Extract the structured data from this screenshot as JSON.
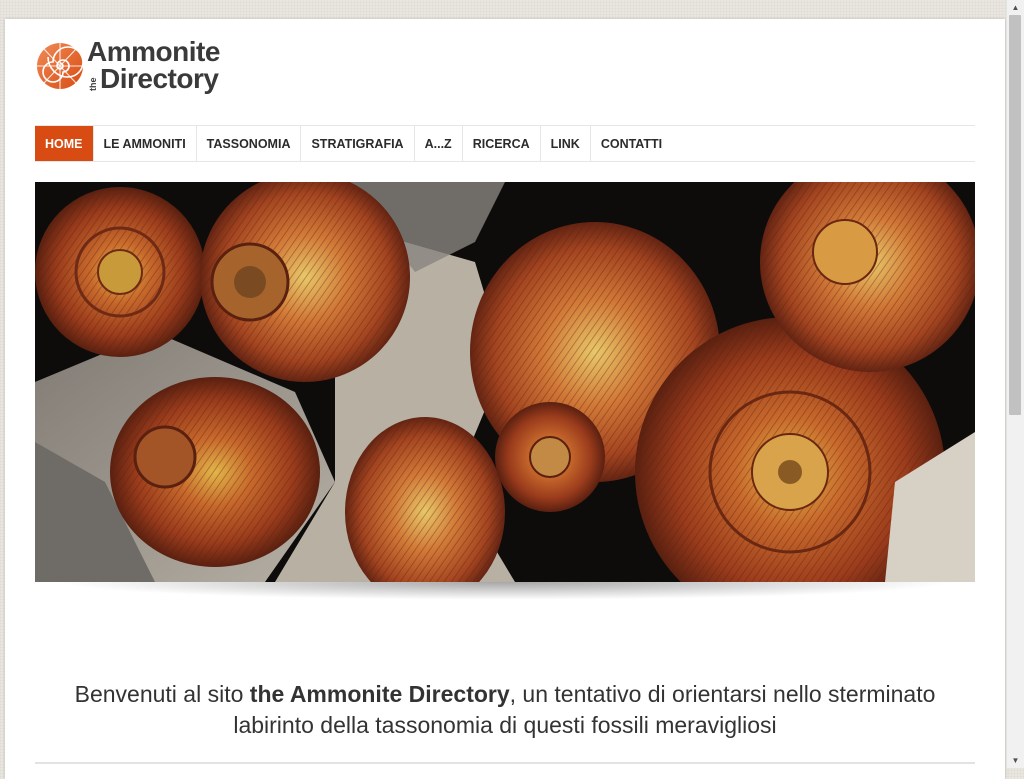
{
  "site": {
    "logo": {
      "line1": "Ammonite",
      "article": "the",
      "line2": "Directory",
      "icon": "ammonite-shell-icon"
    },
    "colors": {
      "accent": "#d84c13",
      "text": "#333333"
    }
  },
  "nav": {
    "items": [
      {
        "label": "HOME",
        "active": true
      },
      {
        "label": "LE AMMONITI",
        "active": false
      },
      {
        "label": "TASSONOMIA",
        "active": false
      },
      {
        "label": "STRATIGRAFIA",
        "active": false
      },
      {
        "label": "A...Z",
        "active": false
      },
      {
        "label": "RICERCA",
        "active": false
      },
      {
        "label": "LINK",
        "active": false
      },
      {
        "label": "CONTATTI",
        "active": false
      }
    ]
  },
  "welcome": {
    "prefix": "Benvenuti al sito ",
    "site_name": "the Ammonite Directory",
    "suffix": ", un tentativo di orientarsi nello sterminato labirinto della tassonomia di questi fossili meravigliosi"
  }
}
